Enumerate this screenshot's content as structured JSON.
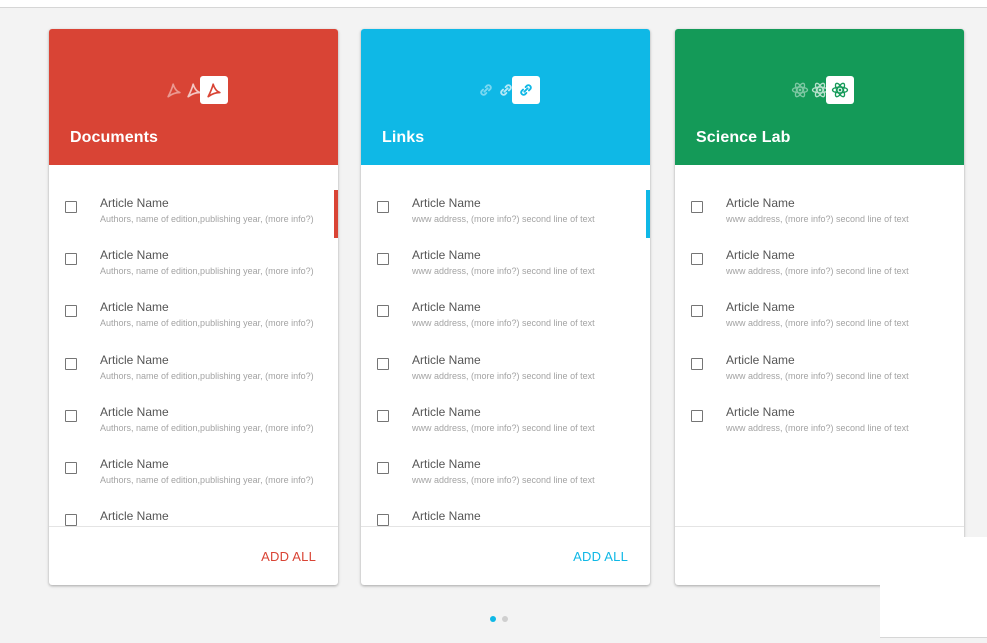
{
  "colors": {
    "documents": "#d94435",
    "links": "#0fb8e6",
    "science": "#149a58",
    "dot_active": "#0fb8e6",
    "dot_inactive": "#cfcfcf"
  },
  "cards": [
    {
      "title": "Documents",
      "icon": "pdf-icon",
      "action_label": "ADD ALL",
      "items": [
        {
          "title": "Article Name",
          "subtitle": "Authors, name of edition,publishing year, (more info?)"
        },
        {
          "title": "Article Name",
          "subtitle": "Authors, name of edition,publishing year, (more info?)"
        },
        {
          "title": "Article Name",
          "subtitle": "Authors, name of edition,publishing year, (more info?)"
        },
        {
          "title": "Article Name",
          "subtitle": "Authors, name of edition,publishing year, (more info?)"
        },
        {
          "title": "Article Name",
          "subtitle": "Authors, name of edition,publishing year, (more info?)"
        },
        {
          "title": "Article Name",
          "subtitle": "Authors, name of edition,publishing year, (more info?)"
        },
        {
          "title": "Article Name",
          "subtitle": ""
        }
      ]
    },
    {
      "title": "Links",
      "icon": "link-icon",
      "action_label": "ADD ALL",
      "items": [
        {
          "title": "Article Name",
          "subtitle": "www address, (more info?) second line of text"
        },
        {
          "title": "Article Name",
          "subtitle": "www address, (more info?) second line of text"
        },
        {
          "title": "Article Name",
          "subtitle": "www address, (more info?) second line of text"
        },
        {
          "title": "Article Name",
          "subtitle": "www address, (more info?) second line of text"
        },
        {
          "title": "Article Name",
          "subtitle": "www address, (more info?) second line of text"
        },
        {
          "title": "Article Name",
          "subtitle": "www address, (more info?) second line of text"
        },
        {
          "title": "Article Name",
          "subtitle": ""
        }
      ]
    },
    {
      "title": "Science Lab",
      "icon": "atom-icon",
      "action_label": "",
      "items": [
        {
          "title": "Article Name",
          "subtitle": "www address, (more info?) second line of text"
        },
        {
          "title": "Article Name",
          "subtitle": "www address, (more info?) second line of text"
        },
        {
          "title": "Article Name",
          "subtitle": "www address, (more info?) second line of text"
        },
        {
          "title": "Article Name",
          "subtitle": "www address, (more info?) second line of text"
        },
        {
          "title": "Article Name",
          "subtitle": "www address, (more info?) second line of text"
        }
      ]
    }
  ],
  "pagination": {
    "count": 2,
    "active_index": 0
  }
}
